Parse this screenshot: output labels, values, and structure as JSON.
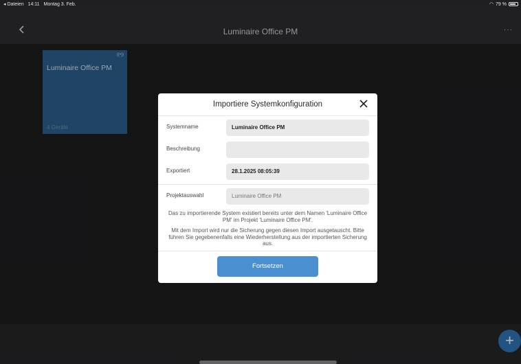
{
  "status_bar": {
    "back_app": "◂ Dateien",
    "time": "14:11",
    "date": "Montag 3. Feb.",
    "battery": "79 %",
    "battery_level": 0.79
  },
  "nav": {
    "title": "Luminaire Office PM",
    "more": "···"
  },
  "tile": {
    "title": "Luminaire Office PM",
    "devices": "4 Geräte"
  },
  "modal": {
    "title": "Importiere Systemkonfiguration",
    "fields": {
      "systemname_label": "Systemname",
      "systemname_value": "Luminaire Office PM",
      "beschreibung_label": "Beschreibung",
      "beschreibung_value": "",
      "exportiert_label": "Exportiert",
      "exportiert_value": "28.1.2025 08:05:39",
      "projekt_label": "Projektauswahl",
      "projekt_value": "Luminaire Office PM"
    },
    "info_1": "Das zu importierende System existiert bereits unter dem Namen 'Luminaire Office PM' im Projekt 'Luminaire Office PM'.",
    "info_2": "Mit dem Import wird nur die Sicherung gegen diesen Import ausgetauscht. Bitte führen Sie gegebenenfalls eine Wiederherstellung aus der importierten Sicherung aus.",
    "continue_label": "Fortsetzen"
  },
  "fab_label": "+",
  "colors": {
    "accent": "#4a8fd0",
    "tile": "#2c5f8c",
    "fab": "#2f75b5"
  }
}
